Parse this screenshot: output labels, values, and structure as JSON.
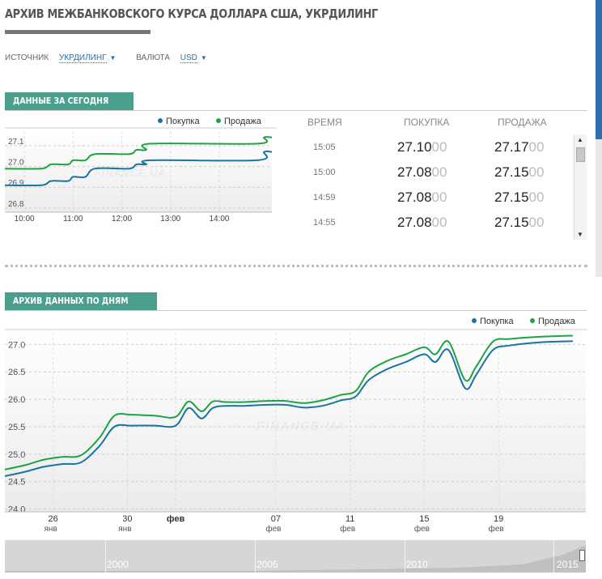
{
  "title": "АРХИВ МЕЖБАНКОВСКОГО КУРСА ДОЛЛАРА США, УКРДИЛИНГ",
  "filters": {
    "source_label": "ИСТОЧНИК",
    "source_value": "УКРДИЛИНГ",
    "currency_label": "ВАЛЮТА",
    "currency_value": "USD"
  },
  "today": {
    "section_title": "ДАННЫЕ ЗА СЕГОДНЯ",
    "table": {
      "headers": {
        "time": "ВРЕМЯ",
        "buy": "ПОКУПКА",
        "sell": "ПРОДАЖА"
      },
      "rows": [
        {
          "time": "15:05",
          "buy": "27.10",
          "buy_dim": "00",
          "sell": "27.17",
          "sell_dim": "00"
        },
        {
          "time": "15:00",
          "buy": "27.08",
          "buy_dim": "00",
          "sell": "27.15",
          "sell_dim": "00"
        },
        {
          "time": "14:59",
          "buy": "27.08",
          "buy_dim": "00",
          "sell": "27.15",
          "sell_dim": "00"
        },
        {
          "time": "14:55",
          "buy": "27.08",
          "buy_dim": "00",
          "sell": "27.15",
          "sell_dim": "00"
        }
      ]
    }
  },
  "archive": {
    "section_title": "АРХИВ ДАННЫХ ПО ДНЯМ"
  },
  "navigator": {
    "years": [
      "2000",
      "2005",
      "2010",
      "2015"
    ]
  },
  "colors": {
    "buy": "#1b73a0",
    "sell": "#1ea345",
    "tag": "#4aa08c"
  },
  "chart_data": [
    {
      "type": "line",
      "name": "today",
      "watermark": "FINANCE.UA",
      "legend": [
        "Покупка",
        "Продажа"
      ],
      "legend_position": "top-right",
      "x_ticks": [
        "10:00",
        "11:00",
        "12:00",
        "13:00",
        "14:00"
      ],
      "y_ticks": [
        "26.8",
        "26.9",
        "27.0",
        "27.1"
      ],
      "ylim": [
        26.78,
        27.17
      ],
      "xlim": [
        9.6,
        15.08
      ],
      "series": [
        {
          "name": "Покупка",
          "x": [
            9.6,
            10.35,
            10.55,
            10.9,
            11.0,
            11.25,
            11.45,
            12.15,
            12.3,
            12.5,
            12.6,
            14.78,
            14.92,
            15.08
          ],
          "y": [
            26.91,
            26.91,
            26.93,
            26.93,
            26.95,
            26.95,
            26.99,
            26.99,
            27.01,
            27.01,
            27.03,
            27.03,
            27.07,
            27.07
          ]
        },
        {
          "name": "Продажа",
          "x": [
            9.6,
            10.35,
            10.55,
            10.9,
            11.0,
            11.25,
            11.45,
            12.15,
            12.3,
            12.5,
            12.6,
            14.78,
            14.92,
            15.08
          ],
          "y": [
            26.99,
            26.99,
            27.01,
            27.01,
            27.03,
            27.03,
            27.06,
            27.06,
            27.08,
            27.08,
            27.11,
            27.11,
            27.14,
            27.14
          ]
        }
      ]
    },
    {
      "type": "line",
      "name": "archive",
      "watermark": "FINANCE.UA",
      "legend": [
        "Покупка",
        "Продажа"
      ],
      "legend_position": "top-right",
      "x_ticks": [
        {
          "day": "26",
          "month": "янв",
          "x": 26
        },
        {
          "day": "30",
          "month": "янв",
          "x": 30
        },
        {
          "day": "фев",
          "month": "",
          "x": 32.6
        },
        {
          "day": "07",
          "month": "фев",
          "x": 38
        },
        {
          "day": "11",
          "month": "фев",
          "x": 42
        },
        {
          "day": "15",
          "month": "фев",
          "x": 46
        },
        {
          "day": "19",
          "month": "фев",
          "x": 50
        }
      ],
      "y_ticks": [
        "24.0",
        "24.5",
        "25.0",
        "25.5",
        "26.0",
        "26.5",
        "27.0"
      ],
      "ylim": [
        23.95,
        27.3
      ],
      "xlim": [
        23.4,
        54.7
      ],
      "series": [
        {
          "name": "Покупка",
          "x": [
            23.4,
            24.5,
            25.5,
            26.5,
            27.5,
            28.5,
            29.3,
            30.2,
            31.5,
            32.6,
            33.3,
            34.0,
            34.6,
            35.3,
            36.3,
            37.5,
            38.5,
            39.5,
            40.5,
            41.5,
            42.3,
            43.0,
            44.0,
            45.0,
            46.0,
            46.6,
            47.3,
            48.2,
            48.8,
            49.7,
            50.6,
            52.3,
            54.0
          ],
          "y": [
            24.6,
            24.68,
            24.77,
            24.82,
            24.85,
            25.15,
            25.5,
            25.52,
            25.52,
            25.52,
            25.84,
            25.65,
            25.84,
            25.88,
            25.88,
            25.9,
            25.9,
            25.85,
            25.88,
            25.98,
            26.05,
            26.35,
            26.55,
            26.68,
            26.82,
            26.68,
            26.9,
            26.2,
            26.45,
            26.9,
            26.98,
            27.04,
            27.06
          ]
        },
        {
          "name": "Продажа",
          "x": [
            23.4,
            24.5,
            25.5,
            26.5,
            27.5,
            28.5,
            29.3,
            30.2,
            31.5,
            32.6,
            33.3,
            34.0,
            34.6,
            35.3,
            36.3,
            37.5,
            38.5,
            39.5,
            40.5,
            41.5,
            42.3,
            43.0,
            44.0,
            45.0,
            46.0,
            46.6,
            47.3,
            48.2,
            48.8,
            49.7,
            50.6,
            52.3,
            54.0
          ],
          "y": [
            24.72,
            24.8,
            24.9,
            24.95,
            24.98,
            25.3,
            25.7,
            25.72,
            25.7,
            25.68,
            25.96,
            25.78,
            25.96,
            25.95,
            25.95,
            25.97,
            25.97,
            25.93,
            25.98,
            26.08,
            26.15,
            26.5,
            26.7,
            26.82,
            26.95,
            26.82,
            27.05,
            26.35,
            26.6,
            27.05,
            27.1,
            27.14,
            27.16
          ]
        }
      ]
    }
  ]
}
